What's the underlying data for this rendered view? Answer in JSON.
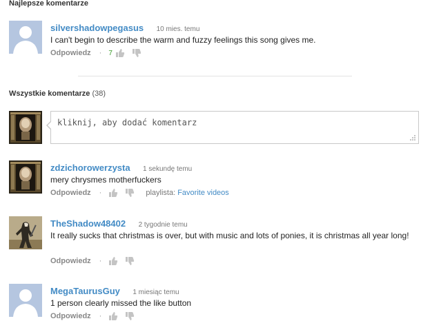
{
  "top_section": {
    "title": "Najlepsze komentarze"
  },
  "all_section": {
    "title": "Wszystkie komentarze",
    "count": "(38)"
  },
  "add_comment": {
    "placeholder": "kliknij, aby dodać komentarz"
  },
  "labels": {
    "reply": "Odpowiedz",
    "separator": "·",
    "playlist_prefix": "playlista:"
  },
  "top_comments": [
    {
      "author": "silvershadowpegasus",
      "time": "10 mies. temu",
      "text": "I can't begin to describe the warm and fuzzy feelings this song gives me.",
      "likes": "7",
      "avatar": "default-avatar"
    }
  ],
  "comments": [
    {
      "author": "zdzichorowerzysta",
      "time": "1 sekundę temu",
      "text": "mery chrysmes motherfuckers",
      "playlist": "Favorite videos",
      "avatar": "ornate-frame-avatar"
    },
    {
      "author": "TheShadow48402",
      "time": "2 tygodnie temu",
      "text": "It really sucks that christmas is over, but with music and lots of ponies, it is christmas all year long!",
      "avatar": "assassin-avatar"
    },
    {
      "author": "MegaTaurusGuy",
      "time": "1 miesiąc temu",
      "text": "1 person clearly missed the like button",
      "avatar": "default-avatar"
    }
  ],
  "colors": {
    "author": "#438bc5",
    "likes": "#3a9b2a",
    "thumb": "#c4c4c4",
    "default_avatar_bg": "#b5c6e0"
  }
}
